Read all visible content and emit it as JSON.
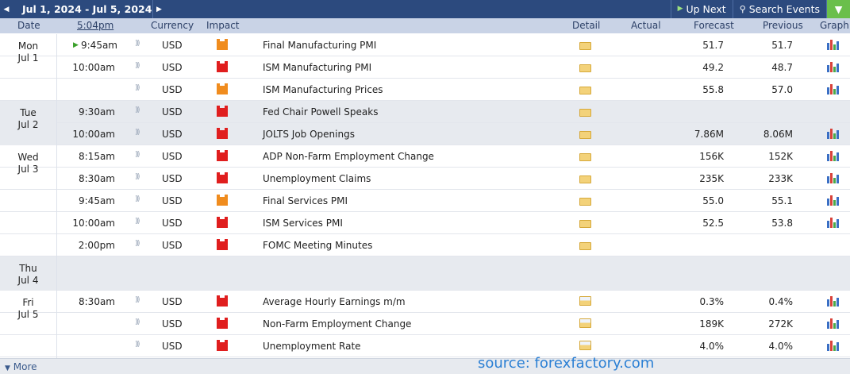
{
  "toolbar": {
    "prev_icon": "triangle-left-icon",
    "date_range": "Jul 1, 2024 - Jul 5, 2024",
    "next_icon": "triangle-right-icon",
    "up_next": "Up Next",
    "search": "Search Events",
    "filter_icon": "filter-icon"
  },
  "header": {
    "date": "Date",
    "time": "5:04pm",
    "currency": "Currency",
    "impact": "Impact",
    "detail": "Detail",
    "actual": "Actual",
    "forecast": "Forecast",
    "previous": "Previous",
    "graph": "Graph"
  },
  "days": [
    {
      "day": "Mon",
      "date": "Jul 1"
    },
    {
      "day": "Tue",
      "date": "Jul 2"
    },
    {
      "day": "Wed",
      "date": "Jul 3"
    },
    {
      "day": "Thu",
      "date": "Jul 4"
    },
    {
      "day": "Fri",
      "date": "Jul 5"
    }
  ],
  "events": [
    {
      "time": "9:45am",
      "currency": "USD",
      "impact": "orange",
      "event": "Final Manufacturing PMI",
      "forecast": "51.7",
      "previous": "51.7",
      "graph": true,
      "doc": false
    },
    {
      "time": "10:00am",
      "currency": "USD",
      "impact": "red",
      "event": "ISM Manufacturing PMI",
      "forecast": "49.2",
      "previous": "48.7",
      "graph": true,
      "doc": false
    },
    {
      "time": "",
      "currency": "USD",
      "impact": "orange",
      "event": "ISM Manufacturing Prices",
      "forecast": "55.8",
      "previous": "57.0",
      "graph": true,
      "doc": false
    },
    {
      "time": "9:30am",
      "currency": "USD",
      "impact": "red",
      "event": "Fed Chair Powell Speaks",
      "forecast": "",
      "previous": "",
      "graph": false,
      "doc": false
    },
    {
      "time": "10:00am",
      "currency": "USD",
      "impact": "red",
      "event": "JOLTS Job Openings",
      "forecast": "7.86M",
      "previous": "8.06M",
      "graph": true,
      "doc": false
    },
    {
      "time": "8:15am",
      "currency": "USD",
      "impact": "red",
      "event": "ADP Non-Farm Employment Change",
      "forecast": "156K",
      "previous": "152K",
      "graph": true,
      "doc": false
    },
    {
      "time": "8:30am",
      "currency": "USD",
      "impact": "red",
      "event": "Unemployment Claims",
      "forecast": "235K",
      "previous": "233K",
      "graph": true,
      "doc": false
    },
    {
      "time": "9:45am",
      "currency": "USD",
      "impact": "orange",
      "event": "Final Services PMI",
      "forecast": "55.0",
      "previous": "55.1",
      "graph": true,
      "doc": false
    },
    {
      "time": "10:00am",
      "currency": "USD",
      "impact": "red",
      "event": "ISM Services PMI",
      "forecast": "52.5",
      "previous": "53.8",
      "graph": true,
      "doc": false
    },
    {
      "time": "2:00pm",
      "currency": "USD",
      "impact": "red",
      "event": "FOMC Meeting Minutes",
      "forecast": "",
      "previous": "",
      "graph": false,
      "doc": false
    },
    {
      "time": "8:30am",
      "currency": "USD",
      "impact": "red",
      "event": "Average Hourly Earnings m/m",
      "forecast": "0.3%",
      "previous": "0.4%",
      "graph": true,
      "doc": true
    },
    {
      "time": "",
      "currency": "USD",
      "impact": "red",
      "event": "Non-Farm Employment Change",
      "forecast": "189K",
      "previous": "272K",
      "graph": true,
      "doc": true
    },
    {
      "time": "",
      "currency": "USD",
      "impact": "red",
      "event": "Unemployment Rate",
      "forecast": "4.0%",
      "previous": "4.0%",
      "graph": true,
      "doc": true
    }
  ],
  "footer": {
    "more": "More",
    "source": "source: forexfactory.com"
  },
  "colors": {
    "bar": "#2c4a7e",
    "header": "#c9d3e6",
    "high_impact": "#e01e1e",
    "medium_impact": "#f08c1e",
    "accent": "#6abf4b"
  }
}
